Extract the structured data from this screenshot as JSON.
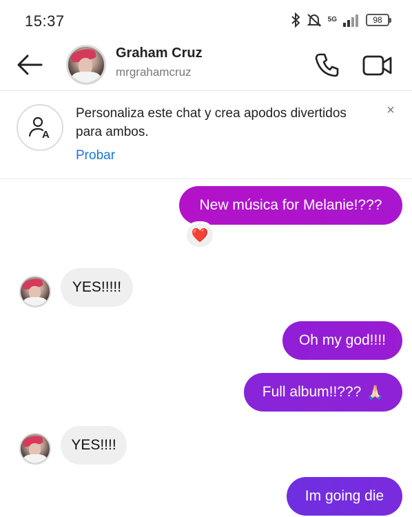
{
  "status_bar": {
    "time": "15:37",
    "network": "5G",
    "battery": "98",
    "icons": [
      "bluetooth-icon",
      "mute-icon",
      "signal-icon",
      "battery-icon"
    ]
  },
  "header": {
    "name": "Graham Cruz",
    "username": "mrgrahamcruz",
    "icons": [
      "back-arrow-icon",
      "phone-icon",
      "video-camera-icon"
    ]
  },
  "banner": {
    "text": "Personaliza este chat y crea apodos divertidos para ambos.",
    "action": "Probar",
    "close": "×",
    "icon": "nickname-icon"
  },
  "messages": [
    {
      "side": "out",
      "text": "New música for Melanie!???"
    },
    {
      "side": "in",
      "text": "YES!!!!!"
    },
    {
      "side": "out",
      "text": "Oh my god!!!!"
    },
    {
      "side": "out",
      "text": "Full album!!???"
    },
    {
      "side": "in",
      "text": "YES!!!!"
    },
    {
      "side": "out",
      "text": "Im going die"
    }
  ],
  "reaction": "❤️",
  "emoji_hands": "🙏🏻",
  "colors": {
    "outgoing_start": "#b312c8",
    "outgoing_end": "#6e2fe0",
    "incoming": "#efefef",
    "link": "#1976d2"
  }
}
